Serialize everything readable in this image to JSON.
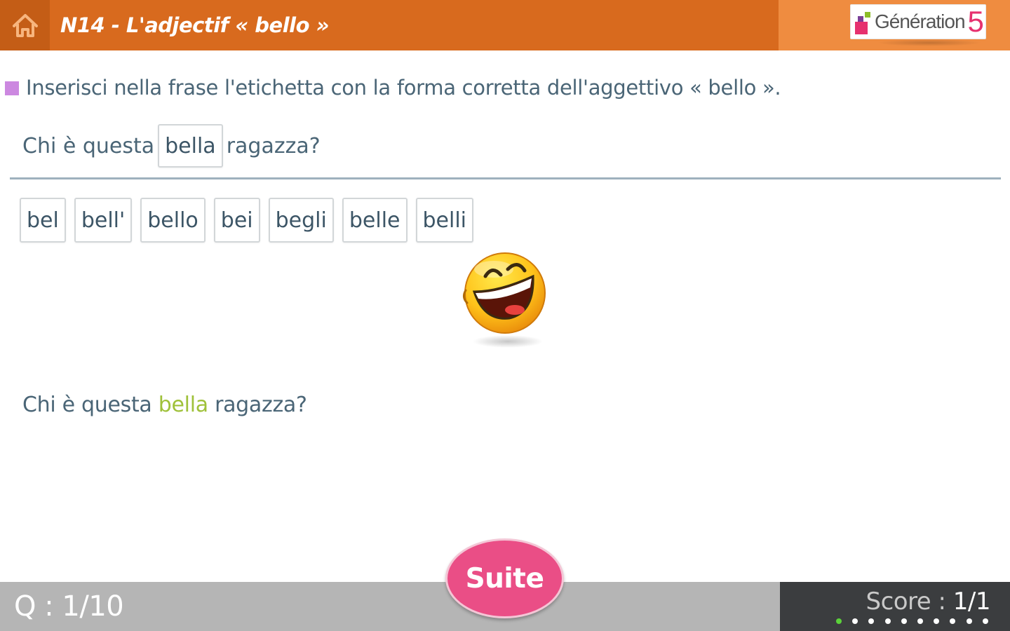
{
  "header": {
    "title": "N14 - L'adjectif « bello »",
    "brand": {
      "name": "Génération",
      "number": "5"
    }
  },
  "exercise": {
    "instruction": "Inserisci nella frase l'etichetta con la forma corretta dell'aggettivo « bello ».",
    "sentence": {
      "before": "Chi è questa",
      "slot_value": "bella",
      "after": "ragazza?"
    },
    "labels": [
      "bel",
      "bell'",
      "bello",
      "bei",
      "begli",
      "belle",
      "belli"
    ],
    "correction": {
      "before": "Chi è questa ",
      "answer": "bella",
      "after": " ragazza?"
    }
  },
  "footer": {
    "question_counter": "Q : 1/10",
    "score_label": "Score : ",
    "score_value": "1/1",
    "next_button": "Suite",
    "progress": {
      "total": 10,
      "completed": 1
    }
  },
  "colors": {
    "header_orange": "#d86a1e",
    "correct_green": "#9fc13a",
    "suite_pink": "#ea4e86",
    "instruction_marker": "#cc88e0"
  },
  "icons": {
    "home": "home-icon",
    "feedback": "laughing-smiley-icon"
  }
}
